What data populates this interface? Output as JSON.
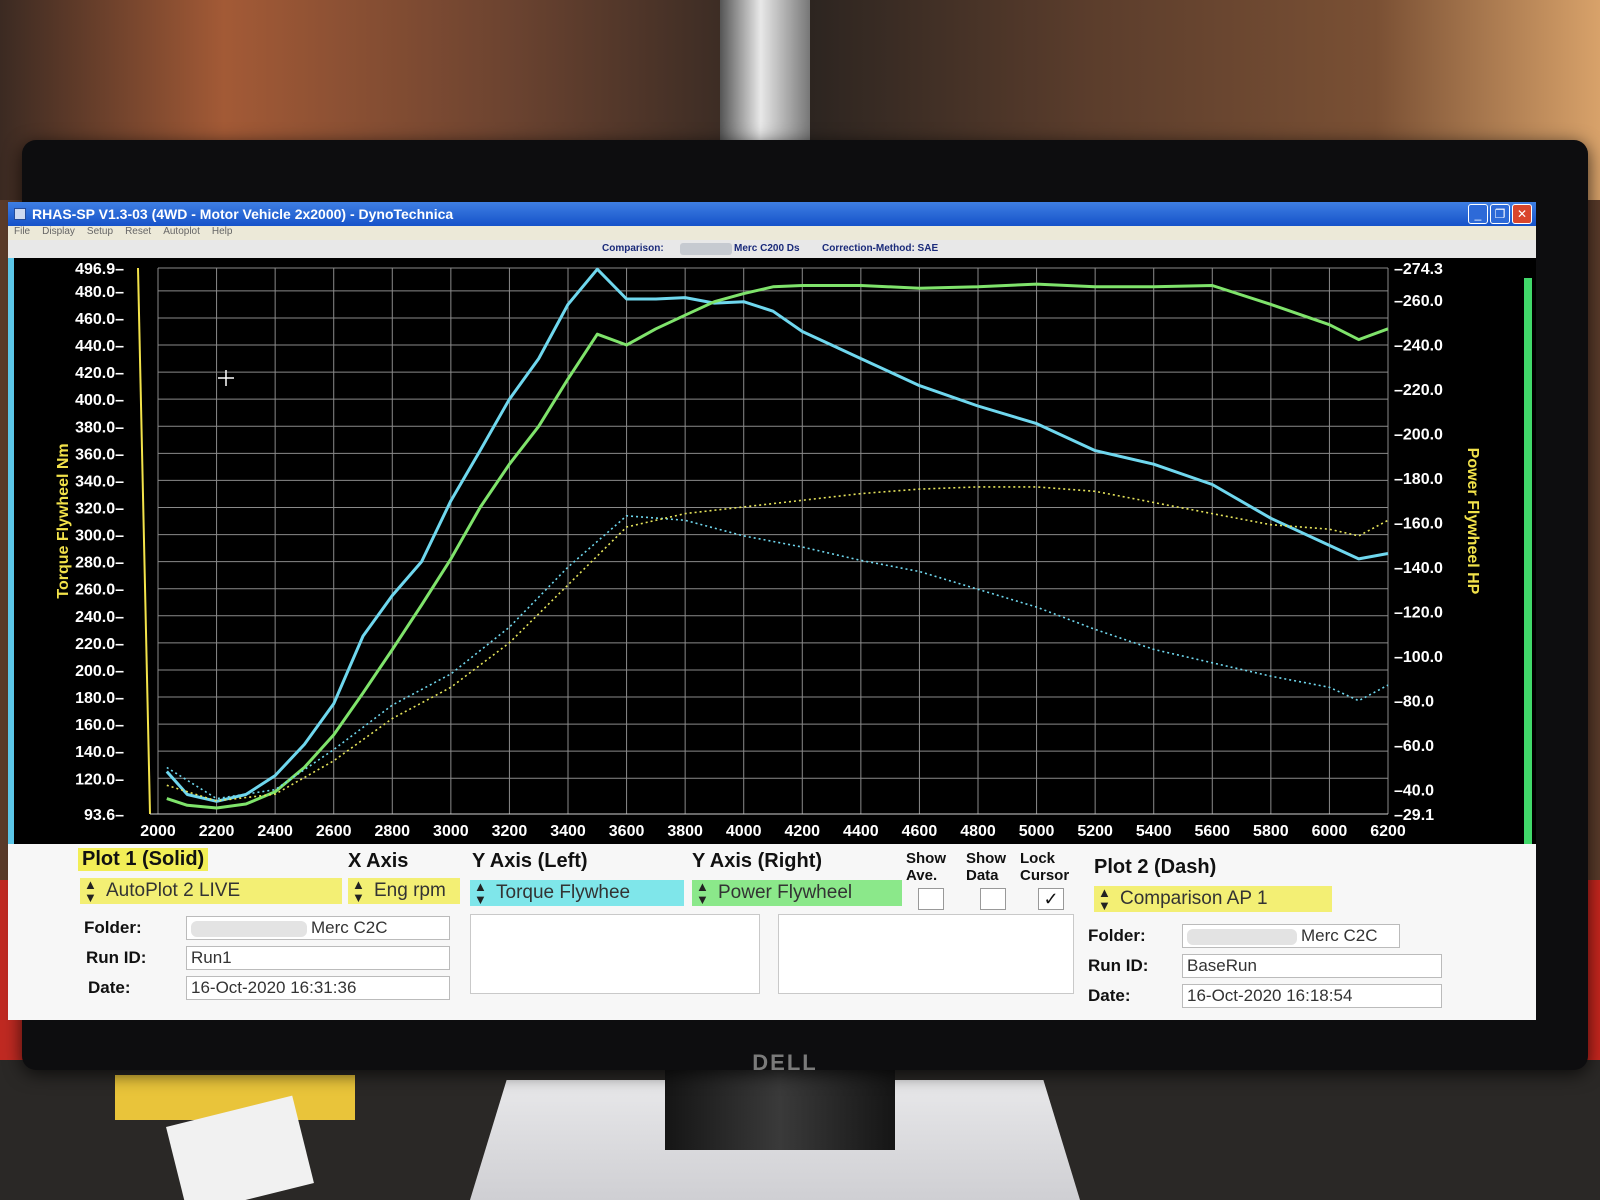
{
  "window": {
    "title": "RHAS-SP V1.3-03  (4WD - Motor Vehicle 2x2000) - DynoTechnica",
    "menu": [
      "File",
      "Display",
      "Setup",
      "Reset",
      "Autoplot",
      "Help"
    ],
    "buttons": {
      "minimize": "_",
      "restore": "❐",
      "close": "✕"
    }
  },
  "infobar": {
    "comparison_label": "Comparison:",
    "run_name": "Merc C200 Ds",
    "correction": "Correction-Method: SAE"
  },
  "colors": {
    "plot1": "#6fd7ee",
    "plot2": "#7fe36b",
    "left_axis": "#f2e24a",
    "grid": "#8a8a8a"
  },
  "chart_data": {
    "type": "line",
    "xlim": [
      2000,
      6200
    ],
    "ylim_left": [
      93.6,
      496.9
    ],
    "ylim_right": [
      29.1,
      274.3
    ],
    "ylabel_left": "Torque Flywheel Nm",
    "ylabel_right": "Power Flywheel HP",
    "x_ticks": [
      2000,
      2200,
      2400,
      2600,
      2800,
      3000,
      3200,
      3400,
      3600,
      3800,
      4000,
      4200,
      4400,
      4600,
      4800,
      5000,
      5200,
      5400,
      5600,
      5800,
      6000,
      6200
    ],
    "y_ticks_left": [
      "496.9",
      "480.0",
      "460.0",
      "440.0",
      "420.0",
      "400.0",
      "380.0",
      "360.0",
      "340.0",
      "320.0",
      "300.0",
      "280.0",
      "260.0",
      "240.0",
      "220.0",
      "200.0",
      "180.0",
      "160.0",
      "140.0",
      "120.0",
      "93.6"
    ],
    "y_ticks_right": [
      "274.3",
      "260.0",
      "240.0",
      "220.0",
      "200.0",
      "180.0",
      "160.0",
      "140.0",
      "120.0",
      "100.0",
      "80.0",
      "60.0",
      "40.0",
      "29.1"
    ],
    "grid": true,
    "series": [
      {
        "axis": "left",
        "style": "solid",
        "color": "#6fd7ee",
        "x": [
          2030,
          2100,
          2200,
          2300,
          2400,
          2500,
          2600,
          2700,
          2800,
          2900,
          3000,
          3100,
          3200,
          3300,
          3400,
          3500,
          3600,
          3700,
          3800,
          3900,
          4000,
          4100,
          4200,
          4300,
          4400,
          4600,
          4800,
          5000,
          5200,
          5400,
          5600,
          5800,
          6000,
          6100,
          6200
        ],
        "y": [
          125,
          108,
          103,
          108,
          122,
          145,
          175,
          225,
          255,
          280,
          325,
          362,
          400,
          430,
          470,
          496,
          474,
          474,
          475,
          471,
          472,
          465,
          450,
          440,
          430,
          410,
          395,
          382,
          362,
          352,
          337,
          312,
          292,
          282,
          286
        ]
      },
      {
        "axis": "left",
        "style": "solid",
        "color": "#7fe36b",
        "x": [
          2030,
          2100,
          2200,
          2300,
          2400,
          2500,
          2600,
          2700,
          2800,
          2900,
          3000,
          3100,
          3200,
          3300,
          3400,
          3500,
          3600,
          3700,
          3800,
          3900,
          4000,
          4100,
          4200,
          4400,
          4600,
          4800,
          5000,
          5200,
          5400,
          5600,
          5800,
          6000,
          6100,
          6200
        ],
        "y": [
          105,
          100,
          98,
          101,
          110,
          128,
          152,
          183,
          215,
          248,
          282,
          320,
          352,
          380,
          415,
          448,
          440,
          452,
          462,
          472,
          478,
          483,
          484,
          484,
          482,
          483,
          485,
          483,
          483,
          484,
          470,
          455,
          444,
          452
        ]
      },
      {
        "axis": "right",
        "style": "dash",
        "color": "#6fd7ee",
        "x": [
          2030,
          2200,
          2400,
          2600,
          2800,
          3000,
          3200,
          3400,
          3600,
          3800,
          4000,
          4200,
          4400,
          4600,
          4800,
          5000,
          5200,
          5400,
          5600,
          5800,
          6000,
          6100,
          6200
        ],
        "y": [
          50,
          36,
          40,
          58,
          78,
          92,
          113,
          140,
          163,
          161,
          154,
          149,
          143,
          138,
          130,
          122,
          112,
          103,
          97,
          91,
          86,
          80,
          87
        ]
      },
      {
        "axis": "right",
        "style": "dash",
        "color": "#e5e35a",
        "x": [
          2030,
          2200,
          2400,
          2600,
          2800,
          3000,
          3200,
          3400,
          3600,
          3800,
          4000,
          4200,
          4400,
          4600,
          4800,
          5000,
          5200,
          5400,
          5600,
          5800,
          6000,
          6100,
          6200
        ],
        "y": [
          42,
          35,
          38,
          53,
          72,
          86,
          106,
          132,
          158,
          164,
          167,
          170,
          173,
          175,
          176,
          176,
          174,
          169,
          164,
          159,
          157,
          154,
          161
        ]
      }
    ]
  },
  "panel": {
    "plot1": {
      "header": "Plot 1 (Solid)",
      "select": "AutoPlot 2 LIVE",
      "folder_label": "Folder:",
      "folder_value": "Merc C2C",
      "runid_label": "Run ID:",
      "runid_value": "Run1",
      "date_label": "Date:",
      "date_value": "16-Oct-2020  16:31:36"
    },
    "xaxis": {
      "header": "X Axis",
      "select": "Eng rpm"
    },
    "yleft": {
      "header": "Y Axis (Left)",
      "select": "Torque Flywhee"
    },
    "yright": {
      "header": "Y Axis (Right)",
      "select": "Power Flywheel"
    },
    "show_ave": "Show\nAve.",
    "show_data": "Show\nData",
    "lock_cursor": "Lock\nCursor",
    "lock_check": "✓",
    "plot2": {
      "header": "Plot 2 (Dash)",
      "select": "Comparison AP 1",
      "folder_label": "Folder:",
      "folder_value": "Merc C2C",
      "runid_label": "Run ID:",
      "runid_value": "BaseRun",
      "date_label": "Date:",
      "date_value": "16-Oct-2020  16:18:54"
    }
  },
  "monitor_brand": "DELL"
}
